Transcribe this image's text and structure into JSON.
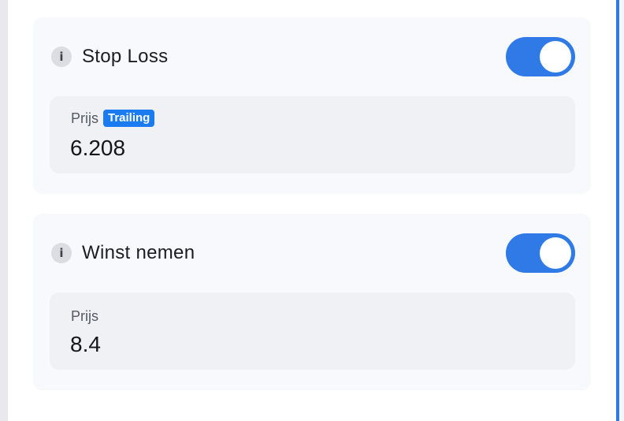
{
  "stop_loss": {
    "title": "Stop Loss",
    "info_icon": "info-icon",
    "toggle_on": true,
    "field": {
      "label": "Prijs",
      "badge": "Trailing",
      "value": "6.208"
    }
  },
  "take_profit": {
    "title": "Winst nemen",
    "info_icon": "info-icon",
    "toggle_on": true,
    "field": {
      "label": "Prijs",
      "value": "8.4"
    }
  },
  "colors": {
    "accent": "#2f7ae6",
    "badge": "#1a7cf0",
    "card_bg": "#f8f9fc",
    "field_bg": "#f0f1f4"
  }
}
